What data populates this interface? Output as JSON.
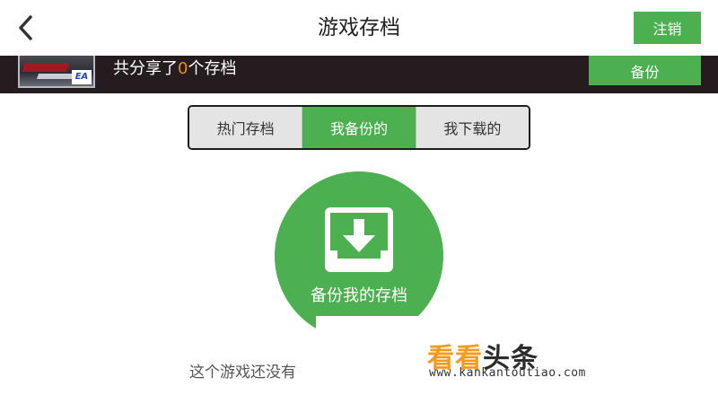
{
  "header": {
    "title": "游戏存档",
    "logout_label": "注销"
  },
  "banner": {
    "share_prefix": "共分享了",
    "share_count": "0",
    "share_suffix": "个存档",
    "backup_label": "备份",
    "thumb_badge": "EA"
  },
  "tabs": [
    {
      "label": "热门存档",
      "active": false
    },
    {
      "label": "我备份的",
      "active": true
    },
    {
      "label": "我下载的",
      "active": false
    }
  ],
  "backup_circle": {
    "label": "备份我的存档"
  },
  "empty_hint": "这个游戏还没有",
  "watermark": {
    "logo_part1": "看看",
    "logo_part2": "头条",
    "url": "www.kankantoutiao.com"
  },
  "colors": {
    "accent": "#4caf50",
    "banner_bg": "#241c1e",
    "count": "#f28c1e"
  },
  "icons": {
    "back": "chevron-left-icon",
    "download": "download-tray-icon"
  }
}
